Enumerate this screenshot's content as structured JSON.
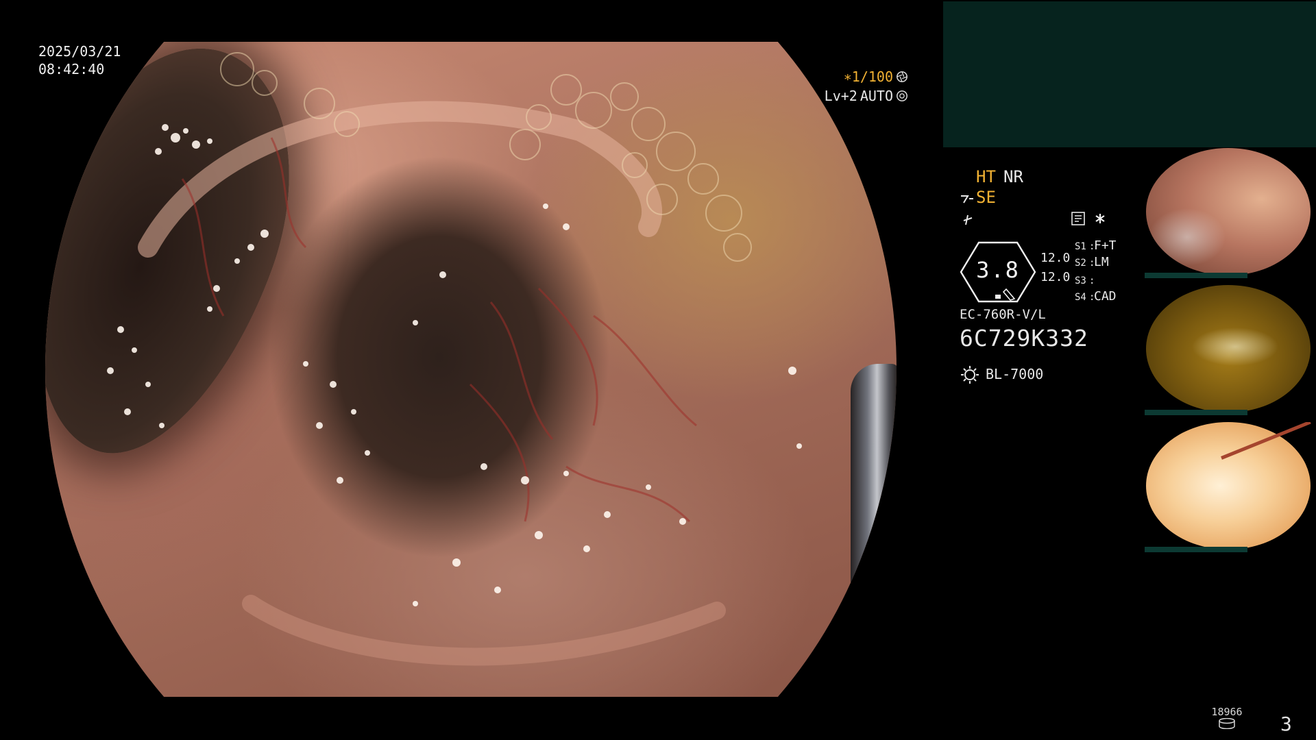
{
  "datetime": {
    "date": "2025/03/21",
    "time": "08:42:40"
  },
  "shutter": {
    "speed": "∗1/100",
    "level": "Lv+2",
    "mode": "AUTO"
  },
  "settings": {
    "ht": "HT",
    "nr": "NR",
    "se": "SE"
  },
  "zoom_display": {
    "value": "3.8",
    "top_num": "12.0",
    "bottom_num": "12.0"
  },
  "switches": [
    {
      "key": "S1",
      "value": "F+T"
    },
    {
      "key": "S2",
      "value": "LM"
    },
    {
      "key": "S3",
      "value": ""
    },
    {
      "key": "S4",
      "value": "CAD"
    }
  ],
  "scope": {
    "model": "EC-760R-V/L",
    "serial": "6C729K332"
  },
  "light": {
    "model": "BL-7000"
  },
  "status": {
    "counter": "18966",
    "page": "3"
  },
  "icons": {
    "shutter": "aperture-icon",
    "auto": "auto-exposure-icon",
    "se": "structure-enhance-icon",
    "mode": "color-mode-icon",
    "memory": "memory-card-icon",
    "asterisk": "asterisk-icon",
    "lamp": "light-source-icon",
    "storage": "storage-disk-icon"
  },
  "colors": {
    "accent": "#f2b233",
    "panel": "#06231e",
    "text": "#e8e8e8"
  }
}
